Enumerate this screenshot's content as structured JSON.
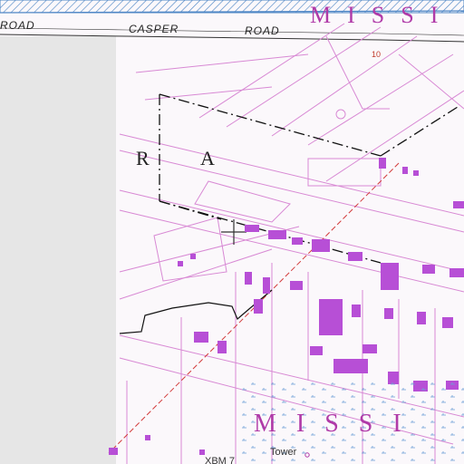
{
  "map": {
    "labels": {
      "road_west": "ROAD",
      "casper": "CASPER",
      "road_east": "ROAD",
      "ra": "R A",
      "missi_top": "MISSI",
      "missi_bottom": "MISSI",
      "tower": "Tower",
      "xbm": "XBM 7",
      "contour": "10"
    },
    "colors": {
      "water_blue": "#4f87c6",
      "urban_magenta": "#c85fc6",
      "building_purple": "#b74fd6",
      "gray_margin": "#e6e6e6",
      "road_line": "#d889d4",
      "boundary_black": "#111111",
      "railway_red": "#d23b3b"
    }
  }
}
